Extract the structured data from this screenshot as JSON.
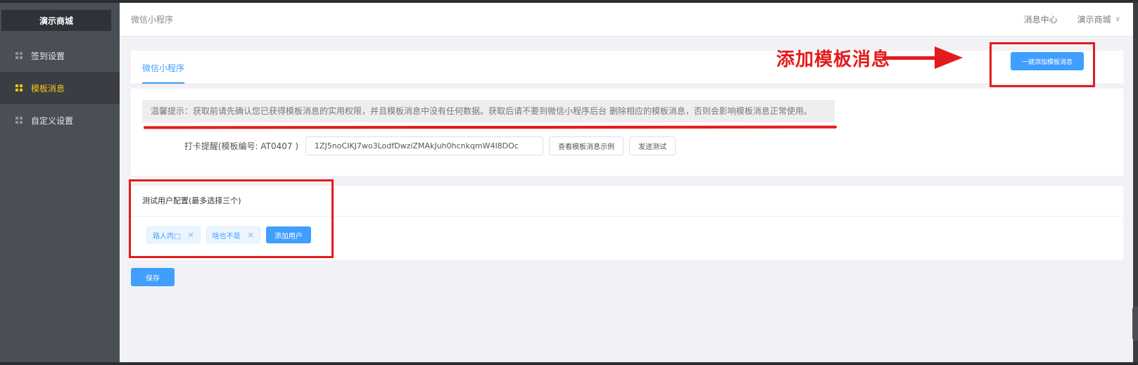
{
  "sidebar": {
    "brand": "演示商城",
    "items": [
      {
        "label": "签到设置",
        "active": false
      },
      {
        "label": "模板消息",
        "active": true
      },
      {
        "label": "自定义设置",
        "active": false
      }
    ]
  },
  "header": {
    "title": "微信小程序",
    "message_center": "消息中心",
    "user": "演示商城"
  },
  "tabs": [
    {
      "label": "微信小程序"
    }
  ],
  "tip": "温馨提示：获取前请先确认您已获得模板消息的实用权限，并且模板消息中没有任何数据。获取后请不要到微信小程序后台 删除相应的模板消息，否则会影响模板消息正常使用。",
  "template": {
    "label": "打卡提醒(模板编号: AT0407 )",
    "value": "1ZJ5noCIKJ7wo3LodfDwziZMAkJuh0hcnkqmW4I8DOc",
    "view_example": "查看模板消息示例",
    "send_test": "发送测试"
  },
  "test_users": {
    "title": "测试用户配置(最多选择三个)",
    "users": [
      {
        "name": "路人丙□"
      },
      {
        "name": "啥也不是"
      }
    ],
    "add_label": "添加用户"
  },
  "save_label": "保存",
  "add_template_label": "一键添加模板消息",
  "annotation_text": "添加模板消息",
  "colors": {
    "primary": "#409eff",
    "sidebar": "#4a4e55",
    "active": "#f5c518",
    "annotation": "#e41b1b"
  }
}
